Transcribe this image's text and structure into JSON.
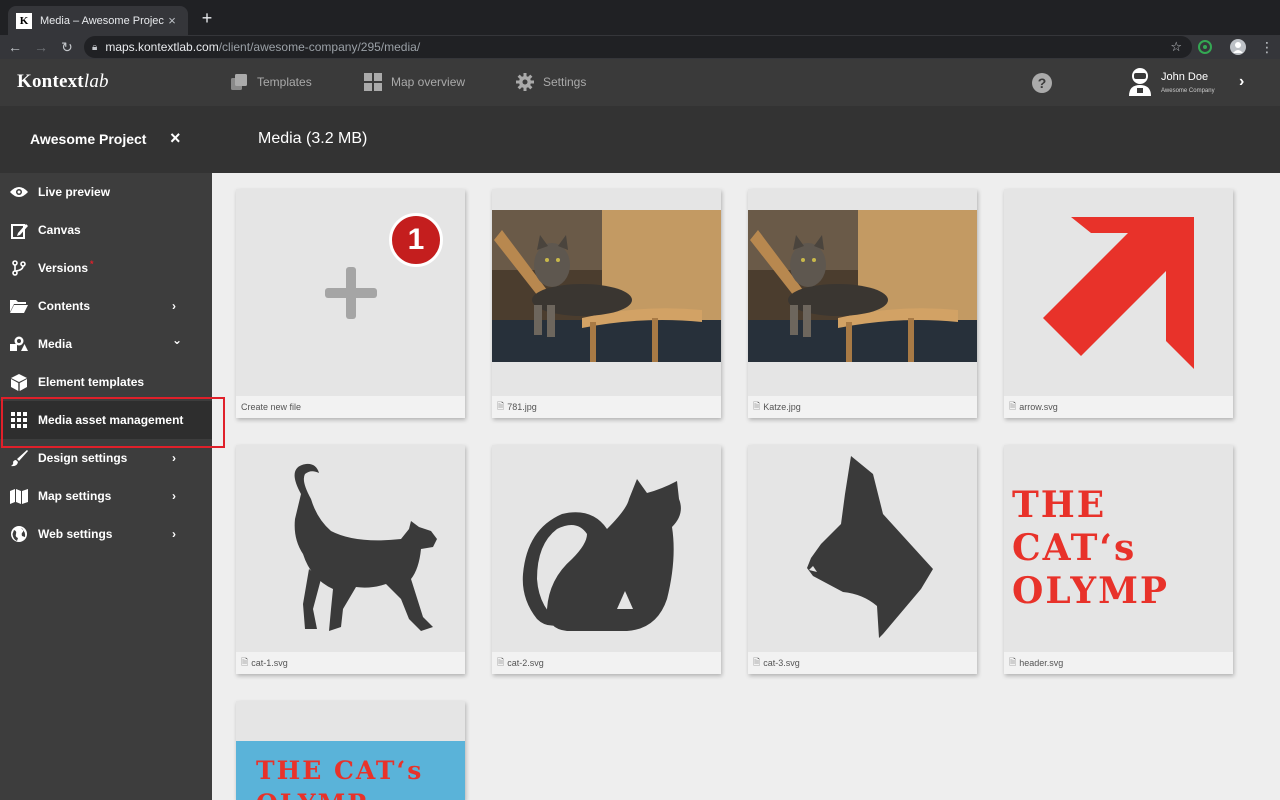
{
  "browser": {
    "tab_favicon": "K",
    "tab_title": "Media – Awesome Project",
    "tab_close": "×",
    "new_tab": "+",
    "url_host": "maps.kontextlab.com",
    "url_path": "/client/awesome-company/295/media/"
  },
  "header": {
    "logo_main": "Kontext",
    "logo_italic": "lab",
    "nav": [
      {
        "label": "Templates",
        "icon": "templates-icon"
      },
      {
        "label": "Map overview",
        "icon": "grid-icon"
      },
      {
        "label": "Settings",
        "icon": "gear-icon"
      }
    ],
    "help": "?",
    "user_name": "John Doe",
    "user_company": "Awesome Company"
  },
  "subheader": {
    "project_title": "Awesome Project",
    "close": "×",
    "page_title": "Media (3.2 MB)"
  },
  "sidebar": {
    "items": [
      {
        "label": "Live preview",
        "icon": "eye-icon"
      },
      {
        "label": "Canvas",
        "icon": "edit-icon"
      },
      {
        "label": "Versions",
        "icon": "branch-icon",
        "indicator": "*"
      },
      {
        "label": "Contents",
        "icon": "folder-icon",
        "chevron": "›"
      },
      {
        "label": "Media",
        "icon": "media-icon",
        "chevron": "⌄"
      },
      {
        "label": "Element templates",
        "icon": "cube-icon"
      },
      {
        "label": "Media asset management",
        "icon": "grid-icon"
      },
      {
        "label": "Design settings",
        "icon": "brush-icon",
        "chevron": "›"
      },
      {
        "label": "Map settings",
        "icon": "map-icon",
        "chevron": "›"
      },
      {
        "label": "Web settings",
        "icon": "globe-icon",
        "chevron": "›"
      }
    ]
  },
  "media": {
    "create_label": "Create new file",
    "badge": "1",
    "files": [
      "781.jpg",
      "Katze.jpg",
      "arrow.svg",
      "cat-1.svg",
      "cat-2.svg",
      "cat-3.svg",
      "header.svg"
    ],
    "header_text_line1": "THE CAT‘s",
    "header_text_line2": "OLYMP",
    "preview_text_line1": "THE CAT‘s",
    "preview_text_line2": "OLYMP"
  },
  "colors": {
    "accent_red": "#e8322a",
    "highlight_box": "#e0202a",
    "sidebar_bg": "#3d3d3d",
    "header_bg": "#3a3a3a"
  }
}
